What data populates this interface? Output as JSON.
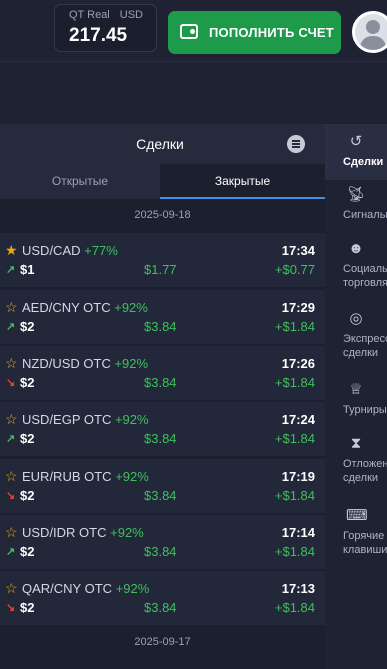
{
  "header": {
    "account_type": "QT Real",
    "currency": "USD",
    "balance": "217.45",
    "deposit_label": "ПОПОЛНИТЬ СЧЕТ"
  },
  "panel": {
    "title": "Сделки",
    "tabs": [
      {
        "label": "Открытые",
        "active": false
      },
      {
        "label": "Закрытые",
        "active": true
      }
    ],
    "dates": [
      "2025-09-18",
      "2025-09-17"
    ],
    "deals": [
      {
        "asset": "USD/CAD",
        "pct": "+77%",
        "time": "17:34",
        "bet": "$1",
        "payout": "$1.77",
        "profit": "+$0.77",
        "direction": "up",
        "favorite": true
      },
      {
        "asset": "AED/CNY OTC",
        "pct": "+92%",
        "time": "17:29",
        "bet": "$2",
        "payout": "$3.84",
        "profit": "+$1.84",
        "direction": "up",
        "favorite": false
      },
      {
        "asset": "NZD/USD OTC",
        "pct": "+92%",
        "time": "17:26",
        "bet": "$2",
        "payout": "$3.84",
        "profit": "+$1.84",
        "direction": "down",
        "favorite": false
      },
      {
        "asset": "USD/EGP OTC",
        "pct": "+92%",
        "time": "17:24",
        "bet": "$2",
        "payout": "$3.84",
        "profit": "+$1.84",
        "direction": "up",
        "favorite": false
      },
      {
        "asset": "EUR/RUB OTC",
        "pct": "+92%",
        "time": "17:19",
        "bet": "$2",
        "payout": "$3.84",
        "profit": "+$1.84",
        "direction": "down",
        "favorite": false
      },
      {
        "asset": "USD/IDR OTC",
        "pct": "+92%",
        "time": "17:14",
        "bet": "$2",
        "payout": "$3.84",
        "profit": "+$1.84",
        "direction": "up",
        "favorite": false
      },
      {
        "asset": "QAR/CNY OTC",
        "pct": "+92%",
        "time": "17:13",
        "bet": "$2",
        "payout": "$3.84",
        "profit": "+$1.84",
        "direction": "down",
        "favorite": false
      }
    ]
  },
  "sidebar": {
    "items": [
      {
        "label": "Сделки",
        "icon": "history-icon",
        "active": true
      },
      {
        "label": "Сигналы",
        "icon": "signal-icon",
        "active": false
      },
      {
        "label": "Социальный",
        "label2": "торговля",
        "icon": "users-icon",
        "active": false
      },
      {
        "label": "Экспресс",
        "label2": "сделки",
        "icon": "target-icon",
        "active": false
      },
      {
        "label": "Турниры",
        "icon": "trophy-icon",
        "active": false
      },
      {
        "label": "Отложенные",
        "label2": "сделки",
        "icon": "hourglass-icon",
        "active": false
      },
      {
        "label": "Горячие",
        "label2": "клавиши",
        "icon": "keyboard-icon",
        "active": false
      }
    ]
  },
  "colors": {
    "positive": "#3ec05b",
    "negative": "#f0422e",
    "deposit_button": "#1e9b4a",
    "accent": "#3a8fe8"
  }
}
